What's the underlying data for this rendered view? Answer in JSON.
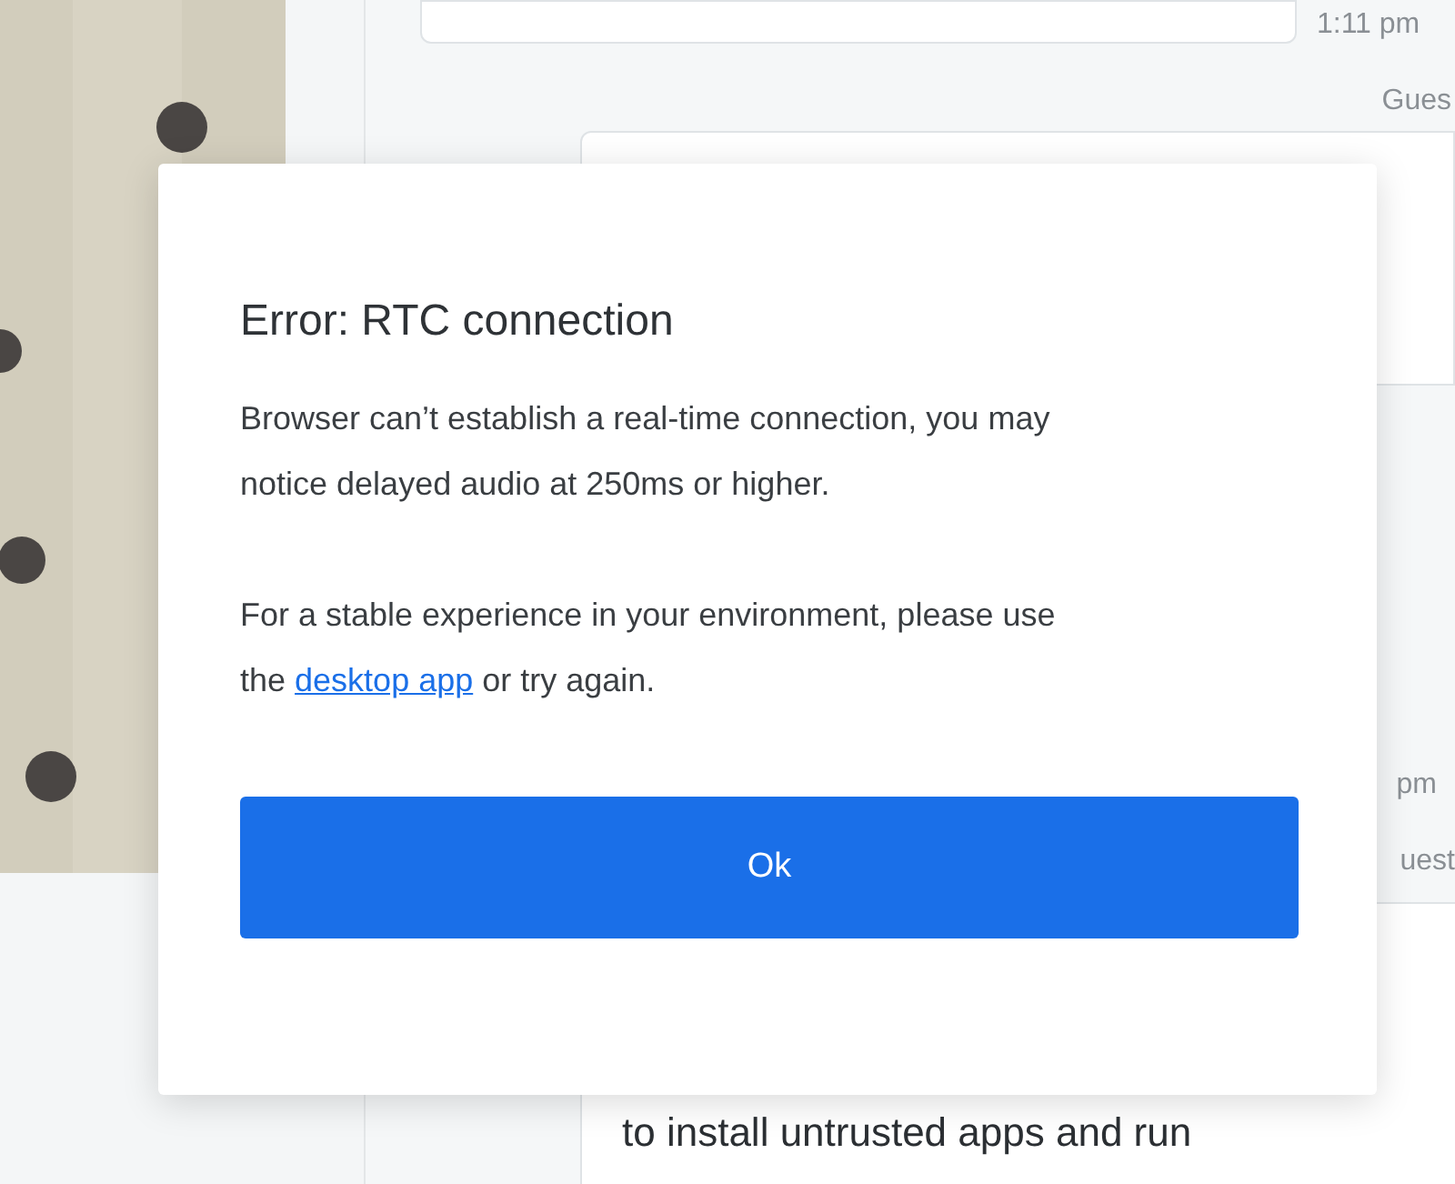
{
  "background": {
    "messages": [
      {
        "time": "1:11 pm",
        "sender": "Gues"
      },
      {
        "time": "pm",
        "sender": "uest"
      }
    ],
    "last_message_text": "to install untrusted apps and run"
  },
  "dialog": {
    "title": "Error: RTC connection",
    "paragraphs": [
      "Browser can’t establish a real-time connection, you may notice delayed audio at 250ms or higher."
    ],
    "stable_note": {
      "before": "For a stable experience in your environment, please use the ",
      "link": "desktop app",
      "after": " or try again."
    },
    "button": "Ok"
  }
}
